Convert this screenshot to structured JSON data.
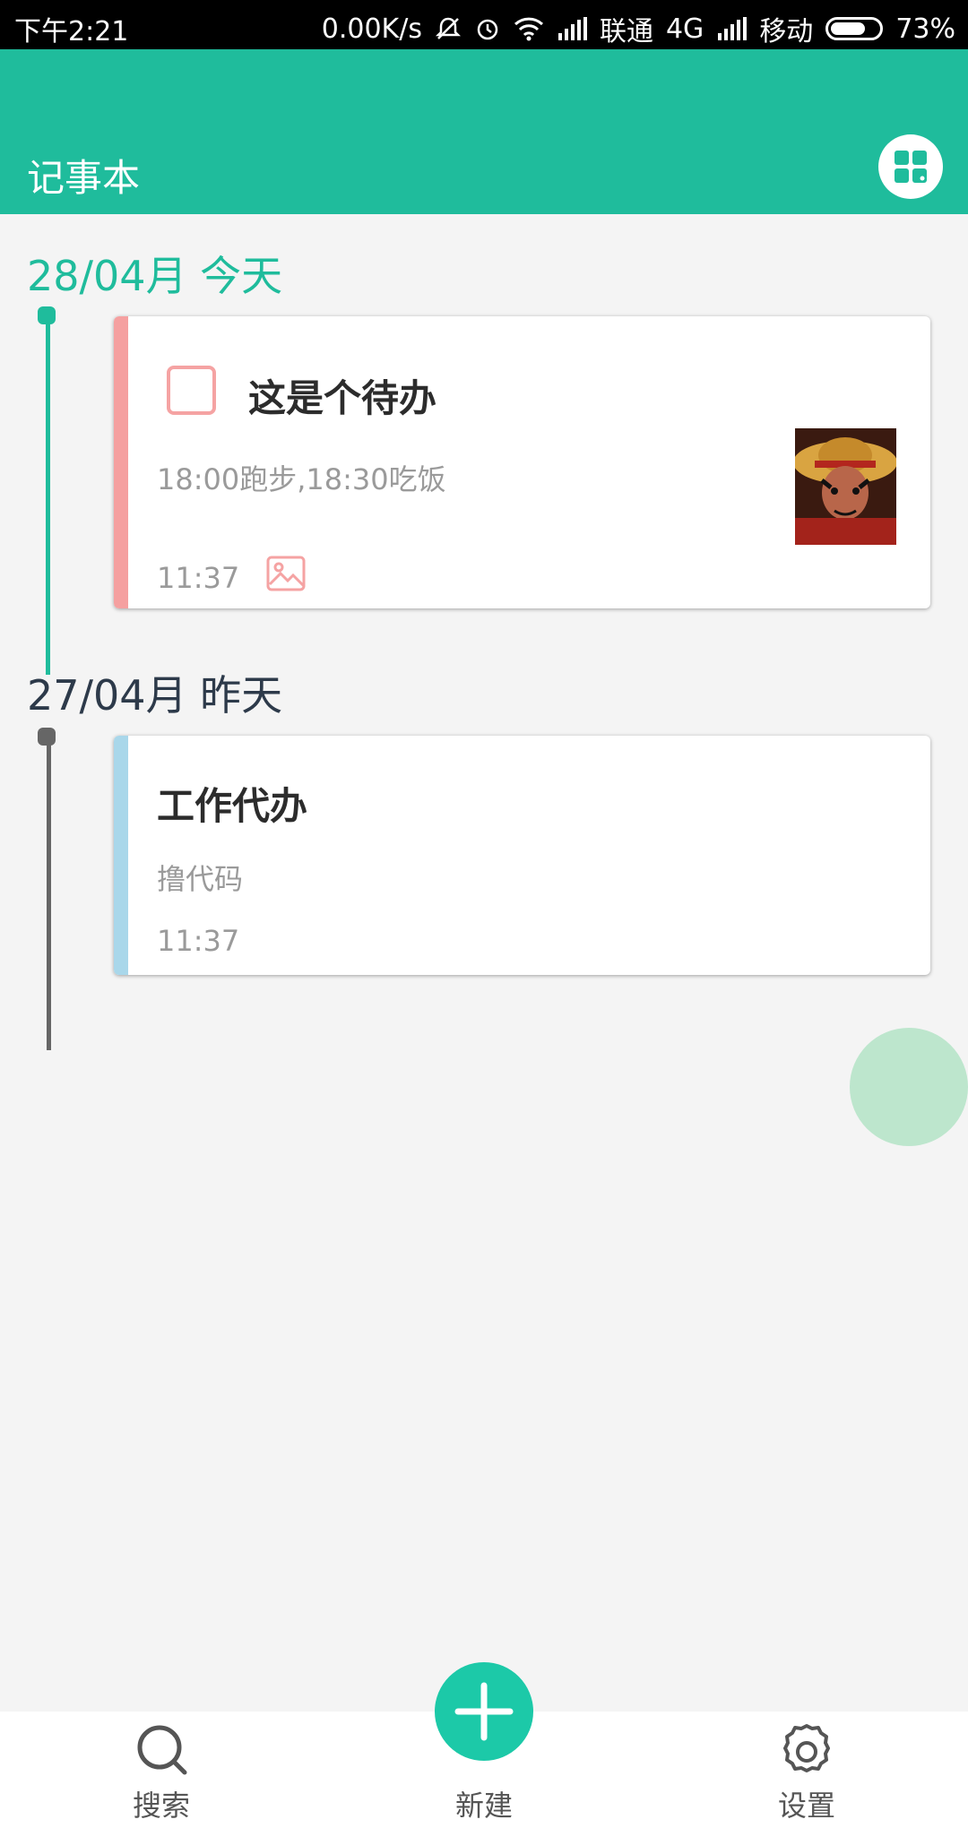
{
  "status_bar": {
    "time": "下午2:21",
    "speed": "0.00K/s",
    "carrier1": "联通",
    "network": "4G",
    "carrier2": "移动",
    "battery": "73%",
    "battery_level": 0.73
  },
  "app": {
    "title": "记事本",
    "accent": "#1fbc9c"
  },
  "groups": [
    {
      "date": "28/04月 今天",
      "notes": [
        {
          "title": "这是个待办",
          "content": "18:00跑步,18:30吃饭",
          "time": "11:37",
          "stripe_color": "#f5a0a0",
          "has_checkbox": true,
          "has_image": true
        }
      ]
    },
    {
      "date": "27/04月 昨天",
      "notes": [
        {
          "title": "工作代办",
          "content": "撸代码",
          "time": "11:37",
          "stripe_color": "#a9d7ea",
          "has_checkbox": false,
          "has_image": false
        }
      ]
    }
  ],
  "bottom_nav": {
    "search_label": "搜索",
    "new_label": "新建",
    "settings_label": "设置"
  }
}
